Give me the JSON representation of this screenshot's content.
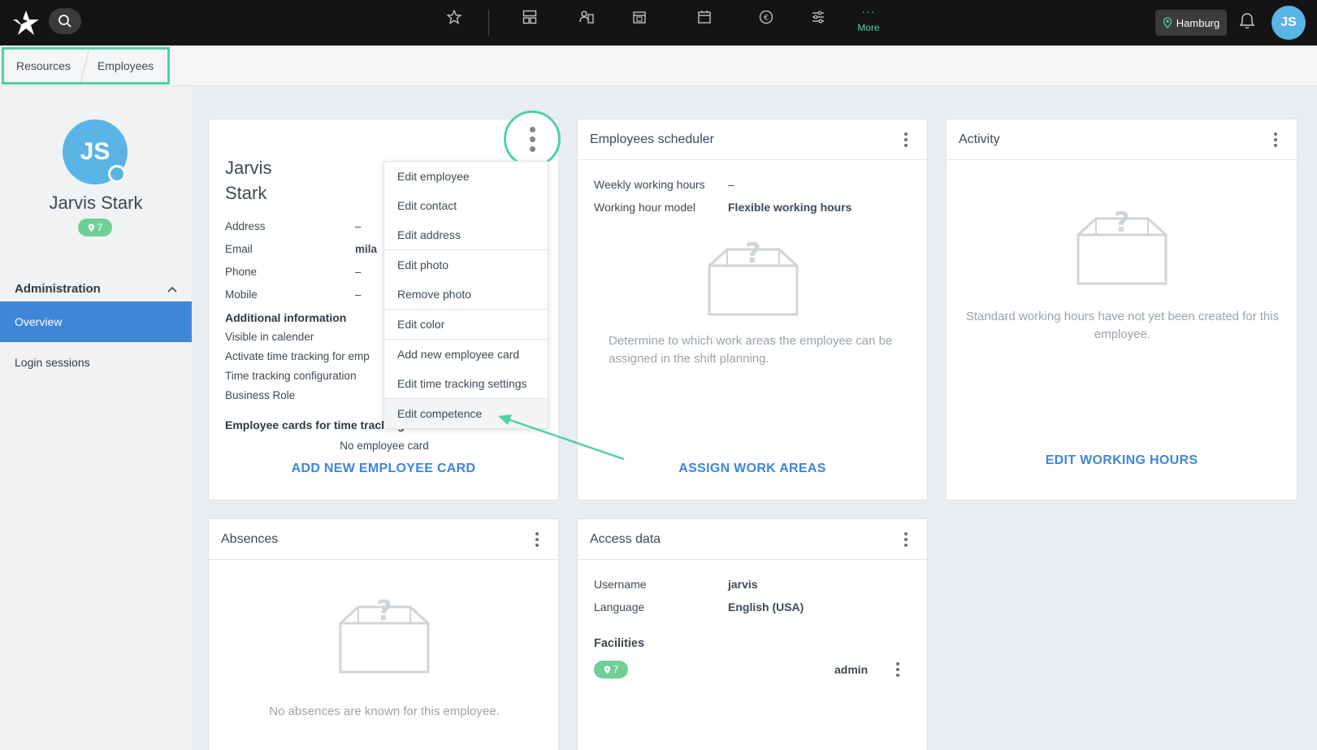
{
  "topbar": {
    "more_label": "More",
    "location_label": "Hamburg",
    "avatar_initials": "JS",
    "accent": "#4fd1a8"
  },
  "breadcrumb": [
    "Resources",
    "Employees"
  ],
  "sidebar": {
    "avatar_initials": "JS",
    "name": "Jarvis Stark",
    "facility_count": "7",
    "section_title": "Administration",
    "items": [
      "Overview",
      "Login sessions"
    ]
  },
  "profile": {
    "first_name": "Jarvis",
    "last_name": "Stark",
    "rows": [
      {
        "label": "Address",
        "value": "–"
      },
      {
        "label": "Email",
        "value": "mila"
      },
      {
        "label": "Phone",
        "value": "–"
      },
      {
        "label": "Mobile",
        "value": "–"
      }
    ],
    "additional_title": "Additional information",
    "additional_rows": [
      "Visible in calender",
      "Activate time tracking for emp",
      "Time tracking configuration",
      "Business Role"
    ],
    "cards_title": "Employee cards for time tracking",
    "no_card": "No employee card",
    "add_card_link": "ADD NEW EMPLOYEE CARD"
  },
  "menu": {
    "groups": [
      [
        "Edit employee",
        "Edit contact",
        "Edit address"
      ],
      [
        "Edit photo",
        "Remove photo"
      ],
      [
        "Edit color"
      ],
      [
        "Add new employee card",
        "Edit time tracking settings"
      ],
      [
        "Edit competence"
      ]
    ]
  },
  "scheduler": {
    "title": "Employees scheduler",
    "weekly_label": "Weekly working hours",
    "weekly_value": "–",
    "model_label": "Working hour model",
    "model_value": "Flexible working hours",
    "empty_text": "Determine to which work areas the employee can be assigned in the shift planning.",
    "link": "ASSIGN WORK AREAS"
  },
  "activity": {
    "title": "Activity",
    "empty_text": "Standard working hours have not yet been created for this employee.",
    "link": "EDIT WORKING HOURS"
  },
  "absences": {
    "title": "Absences",
    "empty_text": "No absences are known for this employee."
  },
  "access": {
    "title": "Access data",
    "username_label": "Username",
    "username_value": "jarvis",
    "language_label": "Language",
    "language_value": "English (USA)",
    "facilities_title": "Facilities",
    "facility_count": "7",
    "facility_role": "admin"
  }
}
